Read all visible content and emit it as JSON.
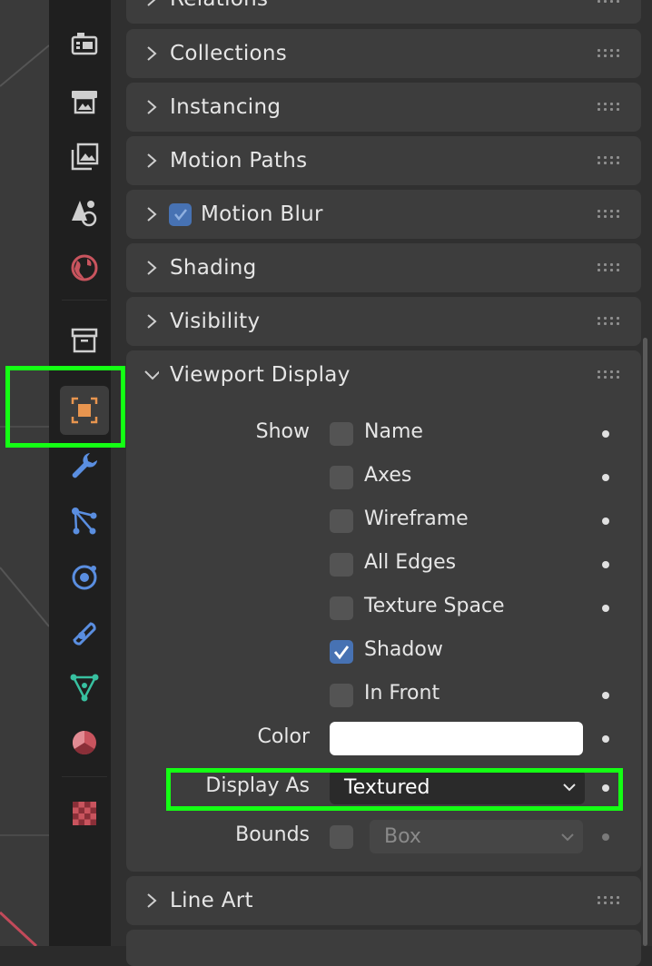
{
  "tabs": {
    "icons": [
      "render-icon",
      "output-icon",
      "view-layer-icon",
      "scene-icon",
      "world-icon",
      "collection-icon",
      "object-icon",
      "modifier-icon",
      "particles-icon",
      "physics-icon",
      "constraints-icon",
      "data-icon",
      "material-icon",
      "texture-icon"
    ],
    "active": "object-icon"
  },
  "panels": {
    "relations": "Relations",
    "collections": "Collections",
    "instancing": "Instancing",
    "motion_paths": "Motion Paths",
    "motion_blur": "Motion Blur",
    "shading": "Shading",
    "visibility": "Visibility",
    "viewport_display": "Viewport Display",
    "line_art": "Line Art"
  },
  "viewport_display": {
    "show_label": "Show",
    "options": [
      {
        "label": "Name",
        "checked": false
      },
      {
        "label": "Axes",
        "checked": false
      },
      {
        "label": "Wireframe",
        "checked": false
      },
      {
        "label": "All Edges",
        "checked": false
      },
      {
        "label": "Texture Space",
        "checked": false
      },
      {
        "label": "Shadow",
        "checked": true
      },
      {
        "label": "In Front",
        "checked": false
      }
    ],
    "color_label": "Color",
    "color_value": "#ffffff",
    "display_as_label": "Display As",
    "display_as_value": "Textured",
    "bounds_label": "Bounds",
    "bounds_value": "Box"
  },
  "colors": {
    "highlight": "#14ff14",
    "checkbox_on": "#4772b3",
    "panel": "#3d3d3d"
  }
}
